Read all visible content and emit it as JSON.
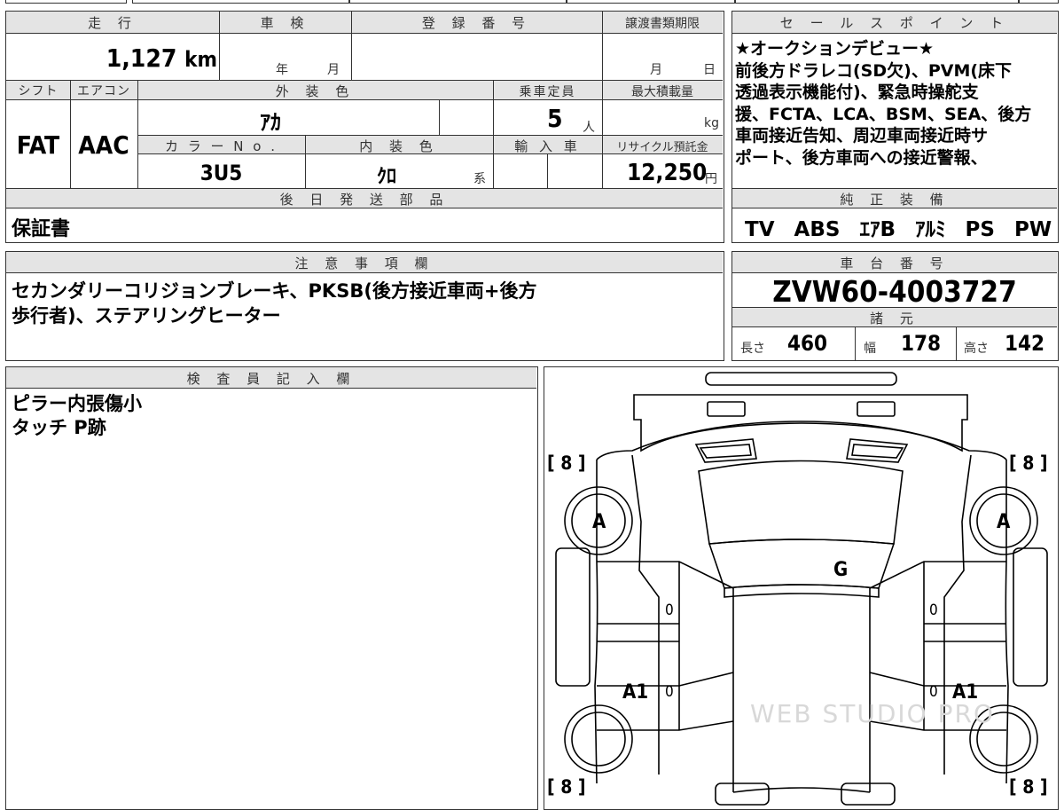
{
  "headers": {
    "mileage": "走 行",
    "shaken": "車 検",
    "reg_no": "登 録 番 号",
    "transfer_deadline": "譲渡書類期限",
    "shift": "シフト",
    "aircon": "エアコン",
    "exterior_color": "外 装 色",
    "capacity": "乗車定員",
    "max_load": "最大積載量",
    "color_no": "カ ラ ー N o .",
    "interior_color": "内 装 色",
    "import": "輸 入 車",
    "recycle": "リサイクル預託金",
    "later_parts": "後 日 発 送 部 品",
    "sales_point": "セ ー ル ス ポ イ ン ト",
    "genuine_equipment": "純 正 装 備",
    "notes": "注 意 事 項 欄",
    "chassis_no": "車 台 番 号",
    "specs": "諸 元",
    "inspector": "検 査 員 記 入 欄"
  },
  "vehicle": {
    "mileage": "1,127",
    "mileage_unit": "km",
    "shaken_year_unit": "年",
    "shaken_month_unit": "月",
    "transfer_month_unit": "月",
    "transfer_day_unit": "日",
    "shift": "FAT",
    "aircon": "AAC",
    "exterior_color": "ｱｶ",
    "capacity": "5",
    "capacity_unit": "人",
    "max_load_unit": "kg",
    "color_no": "3U5",
    "interior_color": "ｸﾛ",
    "interior_suffix": "系",
    "recycle_fee": "12,250",
    "recycle_unit": "円"
  },
  "later_parts": "保証書",
  "sales_point": {
    "lines": [
      "★オークションデビュー★",
      "前後方ドラレコ(SD欠)、PVM(床下",
      "透過表示機能付)、緊急時操舵支",
      "援、FCTA、LCA、BSM、SEA、後方",
      "車両接近告知、周辺車両接近時サ",
      "ポート、後方車両への接近警報、"
    ]
  },
  "equipment": [
    "TV",
    "ABS",
    "ｴｱB",
    "ｱﾙﾐ",
    "PS",
    "PW"
  ],
  "notes": {
    "lines": [
      "セカンダリーコリジョンブレーキ、PKSB(後方接近車両+後方",
      "歩行者)、ステアリングヒーター"
    ]
  },
  "chassis_no": "ZVW60-4003727",
  "specs": {
    "length_label": "長さ",
    "length": "460",
    "width_label": "幅",
    "width": "178",
    "height_label": "高さ",
    "height": "142"
  },
  "inspector_notes": [
    "ピラー内張傷小",
    "タッチ P跡"
  ],
  "diagram": {
    "tire_left_top": "[ 8 ]",
    "tire_right_top": "[ 8 ]",
    "tire_left_bottom": "[ 8 ]",
    "tire_right_bottom": "[ 8 ]",
    "fender_left_front": "A",
    "fender_right_front": "A",
    "windshield": "G",
    "door_left_front": "0",
    "door_right_front": "0",
    "door_left_rear": "0",
    "door_right_rear": "0",
    "rear_left": "A1",
    "rear_right": "A1",
    "watermark": "WEB STUDIO PRO"
  }
}
